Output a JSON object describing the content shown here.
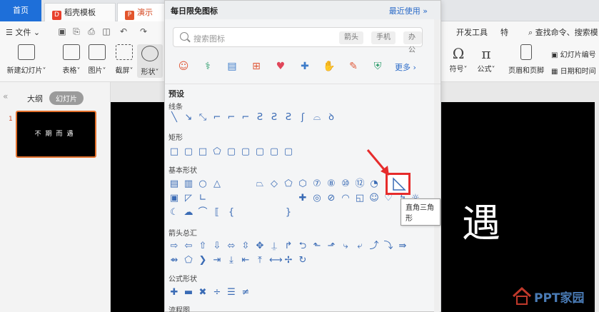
{
  "tabs": {
    "home": "首页",
    "templates": "稻壳模板",
    "doc": "演示文稿"
  },
  "menu": {
    "file": "文件",
    "dev_tools": "开发工具",
    "special": "特",
    "search_cmd": "查找命令、搜索模"
  },
  "ribbon": {
    "new_slide": "新建幻灯片",
    "table": "表格",
    "picture": "图片",
    "screenshot": "截屏",
    "shape": "形状",
    "symbol": "符号",
    "formula": "公式",
    "header_footer": "页眉和页脚",
    "slide_number": "幻灯片编号",
    "date_time": "日期和时间"
  },
  "leftpane": {
    "outline": "大纲",
    "slides": "幻灯片",
    "slide_index": "1",
    "thumb_text": "不期而遇"
  },
  "slide": {
    "big_char": "遇",
    "watermark": "PPT家园"
  },
  "panel": {
    "title": "每日限免图标",
    "recent": "最近使用",
    "search_placeholder": "搜索图标",
    "chips": [
      "箭头",
      "手机",
      "办公"
    ],
    "more": "更多",
    "presets": "预设",
    "categories": {
      "lines": "线条",
      "rect": "矩形",
      "basic": "基本形状",
      "arrows": "箭头总汇",
      "formula": "公式形状",
      "flowchart": "流程图"
    },
    "tooltip": "直角三角形"
  },
  "colors": {
    "accent": "#1e6fd9",
    "highlight": "#e62c2c",
    "shape_stroke": "#3a6bb5"
  }
}
